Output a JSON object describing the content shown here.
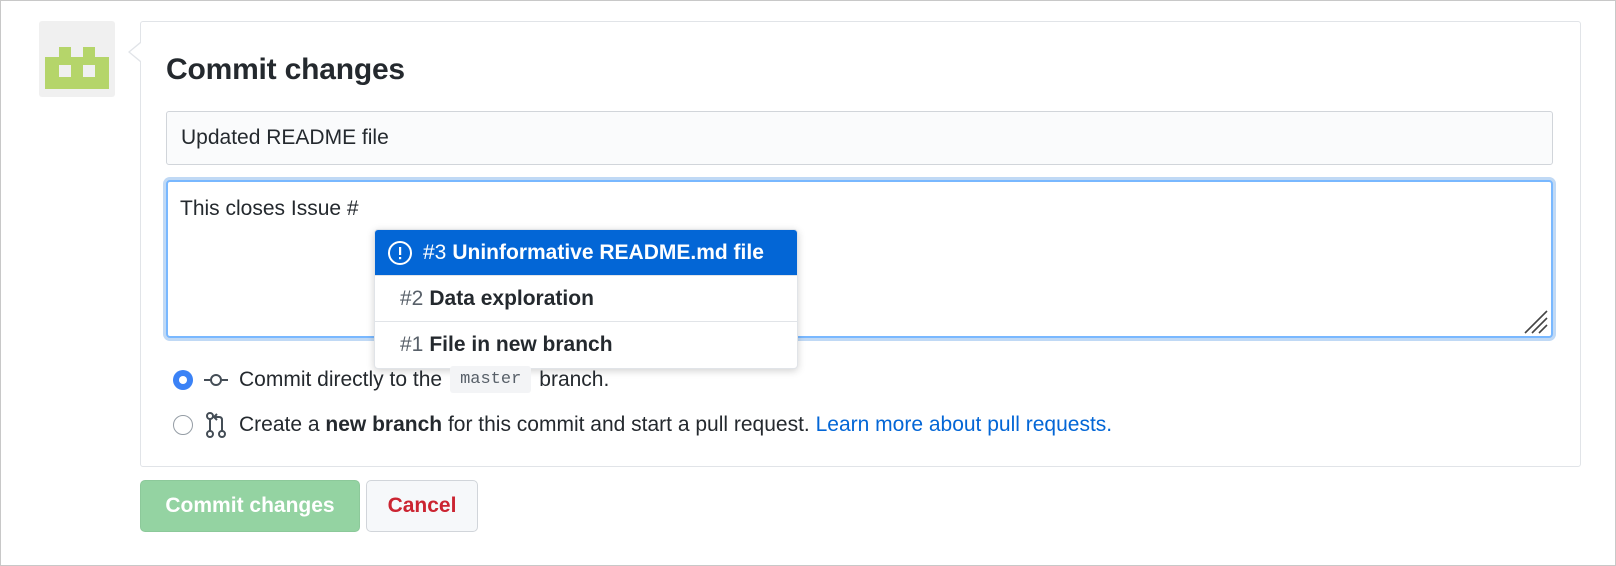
{
  "heading": "Commit changes",
  "summary_field": {
    "value": "Updated README file"
  },
  "description_field": {
    "value": "This closes Issue #"
  },
  "suggestions": [
    {
      "number": "#3",
      "title": "Uninformative README.md file",
      "icon": "issue-opened-icon",
      "active": true
    },
    {
      "number": "#2",
      "title": "Data exploration",
      "active": false
    },
    {
      "number": "#1",
      "title": "File in new branch",
      "active": false
    }
  ],
  "options": {
    "direct": {
      "before": "Commit directly to the",
      "branch": "master",
      "after": "branch.",
      "icon": "git-commit-icon",
      "checked": true
    },
    "new_branch": {
      "prefix": "Create a",
      "bold": "new branch",
      "suffix": "for this commit and start a pull request.",
      "link": "Learn more about pull requests.",
      "icon": "git-pull-request-icon",
      "checked": false
    }
  },
  "buttons": {
    "commit": "Commit changes",
    "cancel": "Cancel"
  },
  "colors": {
    "accent": "#0366d6",
    "commit_button": "#94d3a2",
    "cancel_text": "#cb2431",
    "avatar_green": "#b5d56a"
  },
  "avatar": {
    "icon": "identicon-avatar"
  }
}
